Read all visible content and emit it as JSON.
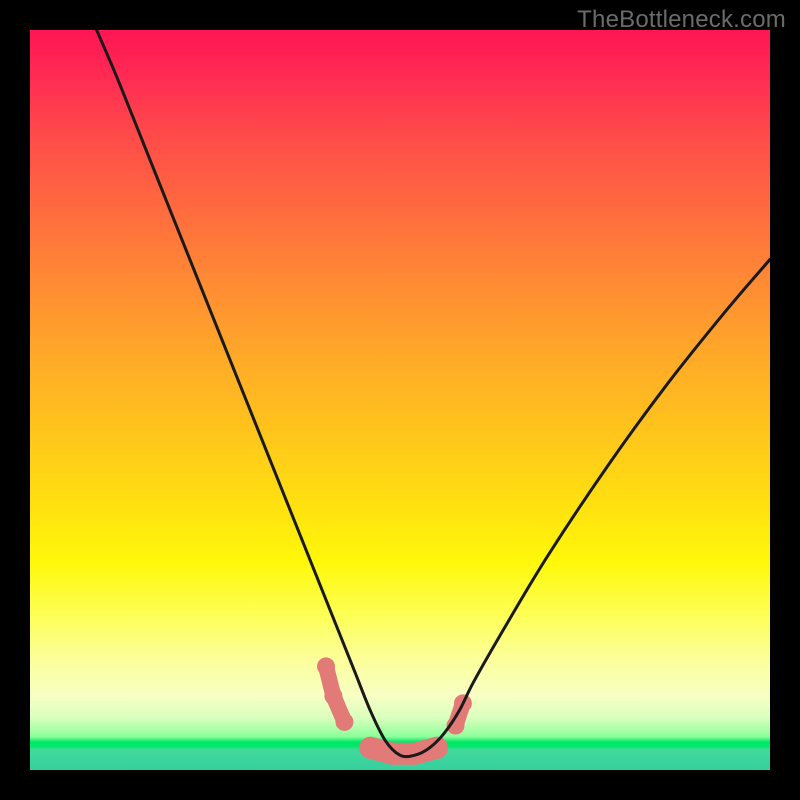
{
  "attribution": "TheBottleneck.com",
  "colors": {
    "frame": "#000000",
    "curve_stroke": "#1a1a1a",
    "marker_fill": "#e27a78",
    "gradient_stops": [
      "#ff1553",
      "#ff6a3f",
      "#ffe010",
      "#fcff9a",
      "#00e869",
      "#36cfa0"
    ]
  },
  "chart_data": {
    "type": "line",
    "title": "",
    "xlabel": "",
    "ylabel": "",
    "xlim": [
      0,
      100
    ],
    "ylim": [
      0,
      100
    ],
    "note": "No axis tick labels or units are visible in the source image; coordinates below are normalized 0–100 in plot-area space estimated from pixel positions. The curve is a V-shaped bottleneck profile with its minimum near x≈49, y≈2.",
    "series": [
      {
        "name": "bottleneck-curve",
        "x": [
          9,
          12,
          16,
          20,
          24,
          28,
          32,
          36,
          38,
          40,
          42,
          44,
          46,
          48,
          50,
          52,
          54,
          56,
          58,
          60,
          64,
          70,
          78,
          86,
          94,
          100
        ],
        "y": [
          100,
          93,
          83,
          73,
          63,
          53,
          43,
          33,
          28,
          23,
          18,
          13,
          8,
          4,
          2,
          2,
          3,
          5,
          8,
          12,
          19,
          29,
          41,
          52,
          62,
          69
        ]
      }
    ],
    "markers": {
      "name": "highlight-cluster",
      "note": "Rounded pink segments near the curve minimum; approximate centers.",
      "points": [
        {
          "x": 40.0,
          "y": 14.0
        },
        {
          "x": 41.0,
          "y": 10.0
        },
        {
          "x": 42.5,
          "y": 6.5
        },
        {
          "x": 46.0,
          "y": 3.0
        },
        {
          "x": 49.0,
          "y": 2.2
        },
        {
          "x": 52.0,
          "y": 2.2
        },
        {
          "x": 55.0,
          "y": 3.0
        },
        {
          "x": 57.5,
          "y": 6.0
        },
        {
          "x": 58.5,
          "y": 9.0
        }
      ]
    }
  }
}
